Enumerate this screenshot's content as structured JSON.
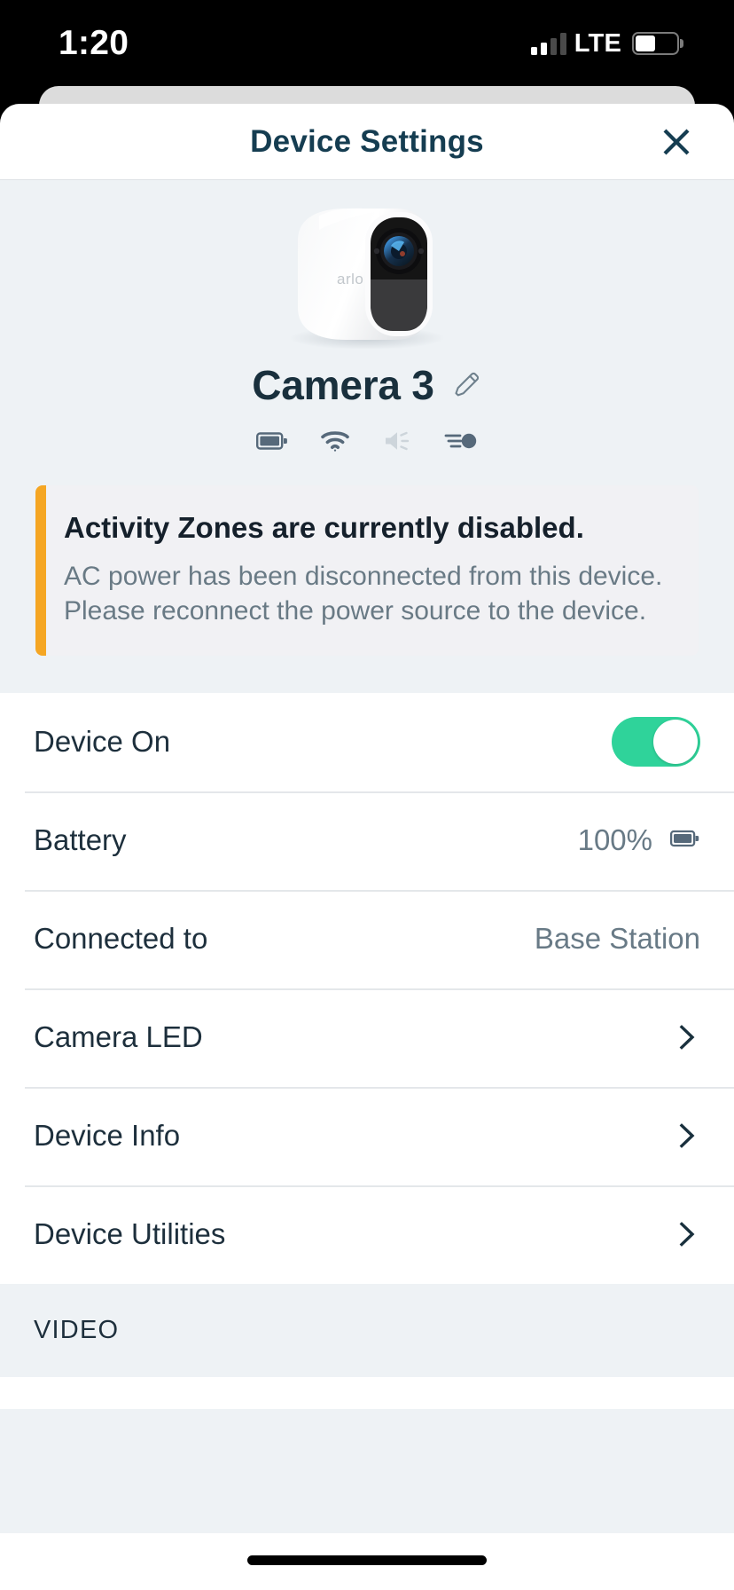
{
  "status_bar": {
    "time": "1:20",
    "carrier_type": "LTE",
    "signal_icon": "cellular-signal-icon",
    "signal_bars_filled": 2,
    "signal_bars_total": 4,
    "battery_icon": "battery-icon",
    "battery_level_percent": 48
  },
  "header": {
    "title": "Device Settings",
    "close_icon": "close-icon"
  },
  "hero": {
    "device_image_alt": "arlo",
    "device_brand_text": "arlo",
    "device_name": "Camera 3",
    "edit_icon": "pencil-icon",
    "status_icons": [
      {
        "name": "battery-icon",
        "label": "Battery",
        "state": "full"
      },
      {
        "name": "wifi-icon",
        "label": "Wi-Fi",
        "state": "active"
      },
      {
        "name": "speaker-icon",
        "label": "Speaker",
        "state": "muted"
      },
      {
        "name": "motion-detection-icon",
        "label": "Motion Detection",
        "state": "active"
      }
    ]
  },
  "alert": {
    "accent_color": "#f5a623",
    "background_color": "#f1f1f4",
    "title": "Activity Zones are currently disabled.",
    "body_line_1": "AC power has been disconnected from this device.",
    "body_line_2": "Please reconnect the power source to the device.",
    "body": "AC power has been disconnected from this device. Please reconnect the power source to the device."
  },
  "settings": {
    "toggle_on_color": "#2fd39a",
    "rows": [
      {
        "label": "Device On",
        "type": "toggle",
        "value": "on",
        "icon": ""
      },
      {
        "label": "Battery",
        "type": "value",
        "value": "100%",
        "icon": "battery-icon"
      },
      {
        "label": "Connected to",
        "type": "value",
        "value": "Base Station",
        "icon": ""
      },
      {
        "label": "Camera LED",
        "type": "link",
        "value": "",
        "icon": "chevron-right-icon"
      },
      {
        "label": "Device Info",
        "type": "link",
        "value": "",
        "icon": "chevron-right-icon"
      },
      {
        "label": "Device Utilities",
        "type": "link",
        "value": "",
        "icon": "chevron-right-icon"
      }
    ]
  },
  "sections": {
    "video_header": "VIDEO"
  }
}
